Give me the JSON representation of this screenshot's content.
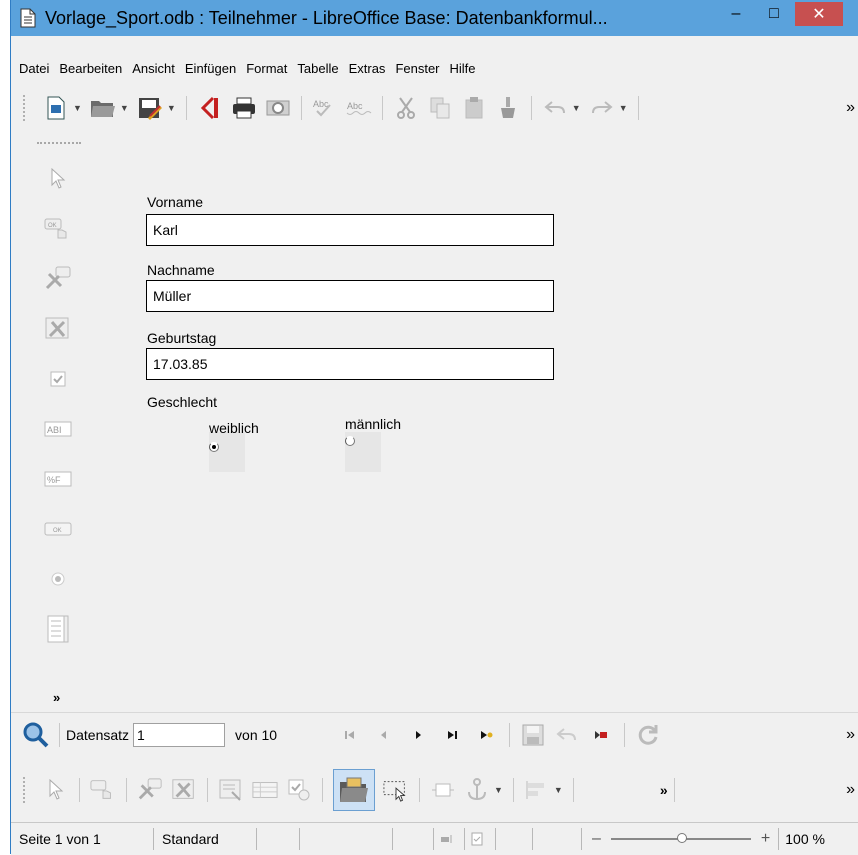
{
  "window": {
    "title": "Vorlage_Sport.odb : Teilnehmer - LibreOffice Base: Datenbankformul...",
    "minimize": "–",
    "maximize": "□",
    "close": "✕"
  },
  "menu": {
    "items": [
      "Datei",
      "Bearbeiten",
      "Ansicht",
      "Einfügen",
      "Format",
      "Tabelle",
      "Extras",
      "Fenster",
      "Hilfe"
    ]
  },
  "toolbar": {
    "more": "»",
    "icons": [
      "new-document-icon",
      "open-folder-icon",
      "edit-file-icon",
      "export-pdf-icon",
      "print-icon",
      "print-preview-icon",
      "spellcheck-icon",
      "autospellcheck-icon",
      "cut-icon",
      "copy-icon",
      "paste-icon",
      "clone-formatting-icon",
      "undo-icon",
      "redo-icon"
    ]
  },
  "form": {
    "fields": [
      {
        "label": "Vorname",
        "value": "Karl"
      },
      {
        "label": "Nachname",
        "value": "Müller"
      },
      {
        "label": "Geburtstag",
        "value": "17.03.85"
      }
    ],
    "gender": {
      "label": "Geschlecht",
      "options": [
        {
          "label": "weiblich",
          "checked": true
        },
        {
          "label": "männlich",
          "checked": false
        }
      ]
    }
  },
  "navigation": {
    "record_label": "Datensatz",
    "record_value": "1",
    "of_label": "von 10",
    "more": "»"
  },
  "form_controls_toolbar": {
    "more": "»",
    "more2": "»"
  },
  "leftbar": {
    "more": "»"
  },
  "statusbar": {
    "page": "Seite 1 von 1",
    "style": "Standard",
    "zoom_minus": "–",
    "zoom_plus": "+",
    "zoom_level": "100 %"
  },
  "colors": {
    "titlebar": "#5aa2dc",
    "close_button": "#c75050"
  }
}
